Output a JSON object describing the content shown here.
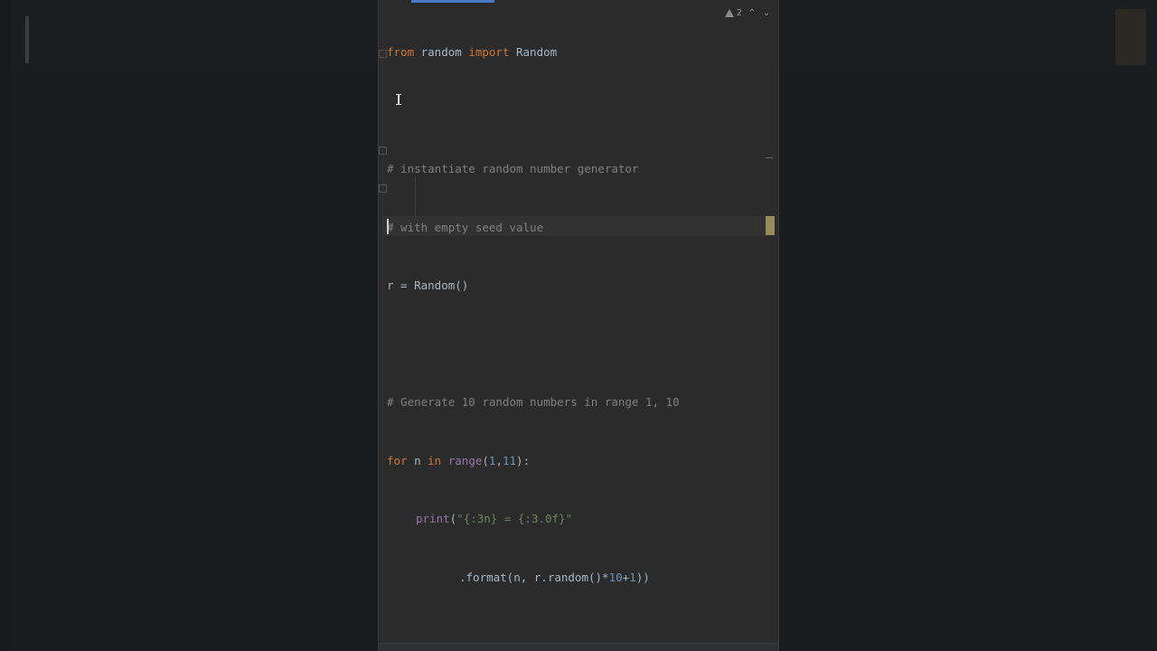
{
  "editor": {
    "inspection_count": "2",
    "colors": {
      "background": "#2b2b2b",
      "keyword": "#cc7832",
      "comment": "#808080",
      "number": "#6897bb",
      "string": "#6a8759",
      "builtin": "#9876aa",
      "text": "#a9b7c6",
      "tab_accent": "#4a78c2"
    }
  },
  "code": {
    "l1": {
      "kw1": "from",
      "mod": " random ",
      "kw2": "import",
      "name": " Random"
    },
    "l3": {
      "text": "# instantiate random number generator"
    },
    "l4": {
      "text": "# with empty seed value"
    },
    "l5": {
      "text": "r = Random()"
    },
    "l7": {
      "text": "# Generate 10 random numbers in range 1, 10"
    },
    "l8": {
      "kw_for": "for",
      "v": " n ",
      "kw_in": "in",
      "sp": " ",
      "fn": "range",
      "p1": "(",
      "n1": "1",
      "comma": ",",
      "n2": "11",
      "p2": "):"
    },
    "l9": {
      "fn": "print",
      "p1": "(",
      "str": "\"{:3n} = {:3.0f}\""
    },
    "l10": {
      "a": ".format(n, r.random()*",
      "n1": "10",
      "plus": "+",
      "n2": "1",
      "b": "))"
    }
  }
}
